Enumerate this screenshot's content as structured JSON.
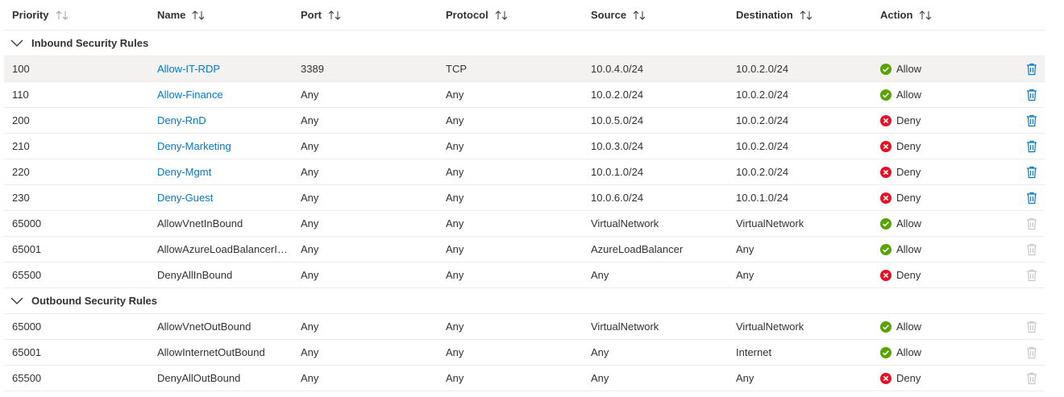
{
  "columns": {
    "priority": "Priority",
    "name": "Name",
    "port": "Port",
    "protocol": "Protocol",
    "source": "Source",
    "destination": "Destination",
    "action": "Action"
  },
  "groups": {
    "inbound": "Inbound Security Rules",
    "outbound": "Outbound Security Rules"
  },
  "inbound": [
    {
      "priority": "100",
      "name": "Allow-IT-RDP",
      "port": "3389",
      "protocol": "TCP",
      "source": "10.0.4.0/24",
      "destination": "10.0.2.0/24",
      "action": "Allow"
    },
    {
      "priority": "110",
      "name": "Allow-Finance",
      "port": "Any",
      "protocol": "Any",
      "source": "10.0.2.0/24",
      "destination": "10.0.2.0/24",
      "action": "Allow"
    },
    {
      "priority": "200",
      "name": "Deny-RnD",
      "port": "Any",
      "protocol": "Any",
      "source": "10.0.5.0/24",
      "destination": "10.0.2.0/24",
      "action": "Deny"
    },
    {
      "priority": "210",
      "name": "Deny-Marketing",
      "port": "Any",
      "protocol": "Any",
      "source": "10.0.3.0/24",
      "destination": "10.0.2.0/24",
      "action": "Deny"
    },
    {
      "priority": "220",
      "name": "Deny-Mgmt",
      "port": "Any",
      "protocol": "Any",
      "source": "10.0.1.0/24",
      "destination": "10.0.2.0/24",
      "action": "Deny"
    },
    {
      "priority": "230",
      "name": "Deny-Guest",
      "port": "Any",
      "protocol": "Any",
      "source": "10.0.6.0/24",
      "destination": "10.0.1.0/24",
      "action": "Deny"
    },
    {
      "priority": "65000",
      "name": "AllowVnetInBound",
      "port": "Any",
      "protocol": "Any",
      "source": "VirtualNetwork",
      "destination": "VirtualNetwork",
      "action": "Allow"
    },
    {
      "priority": "65001",
      "name": "AllowAzureLoadBalancerInB…",
      "port": "Any",
      "protocol": "Any",
      "source": "AzureLoadBalancer",
      "destination": "Any",
      "action": "Allow"
    },
    {
      "priority": "65500",
      "name": "DenyAllInBound",
      "port": "Any",
      "protocol": "Any",
      "source": "Any",
      "destination": "Any",
      "action": "Deny"
    }
  ],
  "outbound": [
    {
      "priority": "65000",
      "name": "AllowVnetOutBound",
      "port": "Any",
      "protocol": "Any",
      "source": "VirtualNetwork",
      "destination": "VirtualNetwork",
      "action": "Allow"
    },
    {
      "priority": "65001",
      "name": "AllowInternetOutBound",
      "port": "Any",
      "protocol": "Any",
      "source": "Any",
      "destination": "Internet",
      "action": "Allow"
    },
    {
      "priority": "65500",
      "name": "DenyAllOutBound",
      "port": "Any",
      "protocol": "Any",
      "source": "Any",
      "destination": "Any",
      "action": "Deny"
    }
  ],
  "colors": {
    "link": "#0078d4",
    "allow": "#57a300",
    "deny": "#e81123",
    "delete_enabled": "#0078d4",
    "delete_disabled": "#c8c6c4",
    "selected_row": "#f3f2f1"
  },
  "icons": {
    "sort": "sort-icon",
    "collapse": "chevron-down-icon",
    "allow": "check-circle-icon",
    "deny": "x-circle-icon",
    "delete": "trash-icon"
  }
}
